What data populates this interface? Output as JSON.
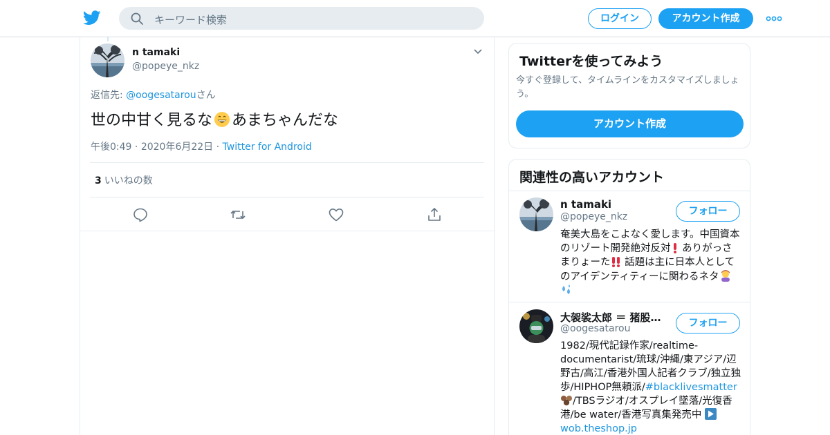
{
  "header": {
    "search_placeholder": "キーワード検索",
    "login_label": "ログイン",
    "signup_label": "アカウント作成"
  },
  "tweet": {
    "author_name": "n tamaki",
    "author_handle": "@popeye_nkz",
    "reply_prefix": "返信先: ",
    "reply_handle": "@oogesatarou",
    "reply_suffix": "さん",
    "text_before_emoji": "世の中甘く見るな",
    "emoji": "grinning-face-emoji",
    "text_after_emoji": "あまちゃんだな",
    "time": "午後0:49",
    "date": "2020年6月22日",
    "source": "Twitter for Android",
    "like_count": "3",
    "like_label": "いいねの数"
  },
  "signup_card": {
    "title": "Twitterを使ってみよう",
    "description": "今すぐ登録して、タイムラインをカスタマイズしましょう。",
    "button_label": "アカウント作成"
  },
  "related": {
    "title": "関連性の高いアカウント",
    "accounts": [
      {
        "name": "n tamaki",
        "handle": "@popeye_nkz",
        "follow_label": "フォロー",
        "bio_1": "奄美大島をこよなく愛します。中国資本のリゾート開発絶対反対",
        "bio_2": "ありがっさまりょーた",
        "bio_3": "話題は主に日本人としてのアイデンティティーに関わるネタ"
      },
      {
        "name": "大袈裟太郎 ＝ 猪股東吾",
        "handle": "@oogesatarou",
        "follow_label": "フォロー",
        "bio_1": "1982/現代記録作家/realtime-documentarist/琉球/沖縄/東アジア/辺野古/高江/香港外国人記者クラブ/独立独歩/HIPHOP無頼派/",
        "hashtag": "#blacklivesmatter",
        "bio_2": "/TBSラジオ/オスプレイ墜落/光復香港/be water/香港写真集発売中",
        "link": "wob.theshop.jp"
      }
    ]
  },
  "colors": {
    "accent": "#1da1f2",
    "link": "#1b95e0",
    "muted": "#657786",
    "text": "#14171a",
    "border": "#e6ecf0",
    "search_bg": "#e6ecf0"
  }
}
